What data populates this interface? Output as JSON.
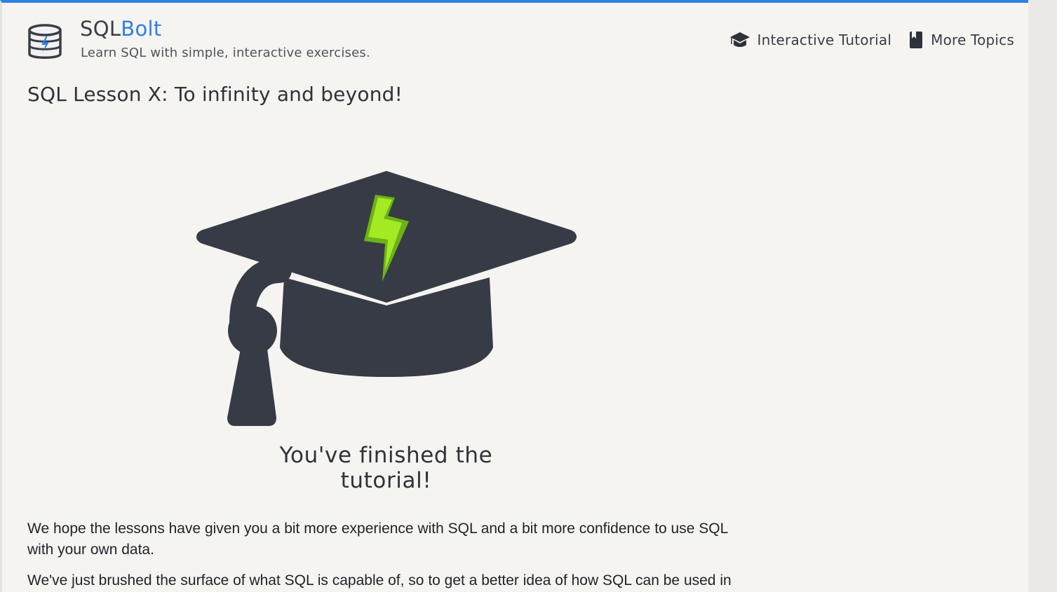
{
  "brand": {
    "name_part1": "SQL",
    "name_part2": "Bolt",
    "tagline": "Learn SQL with simple, interactive exercises."
  },
  "nav": {
    "items": [
      {
        "label": "Interactive Tutorial",
        "icon": "graduation-cap-icon"
      },
      {
        "label": "More Topics",
        "icon": "book-icon"
      }
    ]
  },
  "lesson": {
    "title": "SQL Lesson X: To infinity and beyond!"
  },
  "completion": {
    "image_icon": "graduation-cap-bolt-icon",
    "caption": "You've finished the tutorial!"
  },
  "content": {
    "paragraph1": "We hope the lessons have given you a bit more experience with SQL and a bit more confidence to use SQL with your own data.",
    "paragraph2": "We've just brushed the surface of what SQL is capable of, so to get a better idea of how SQL can be used in"
  },
  "colors": {
    "accent_blue": "#2e7fe6",
    "cap_dark": "#373b46",
    "bolt_green": "#8fd11c",
    "page_bg": "#f5f4f1"
  }
}
